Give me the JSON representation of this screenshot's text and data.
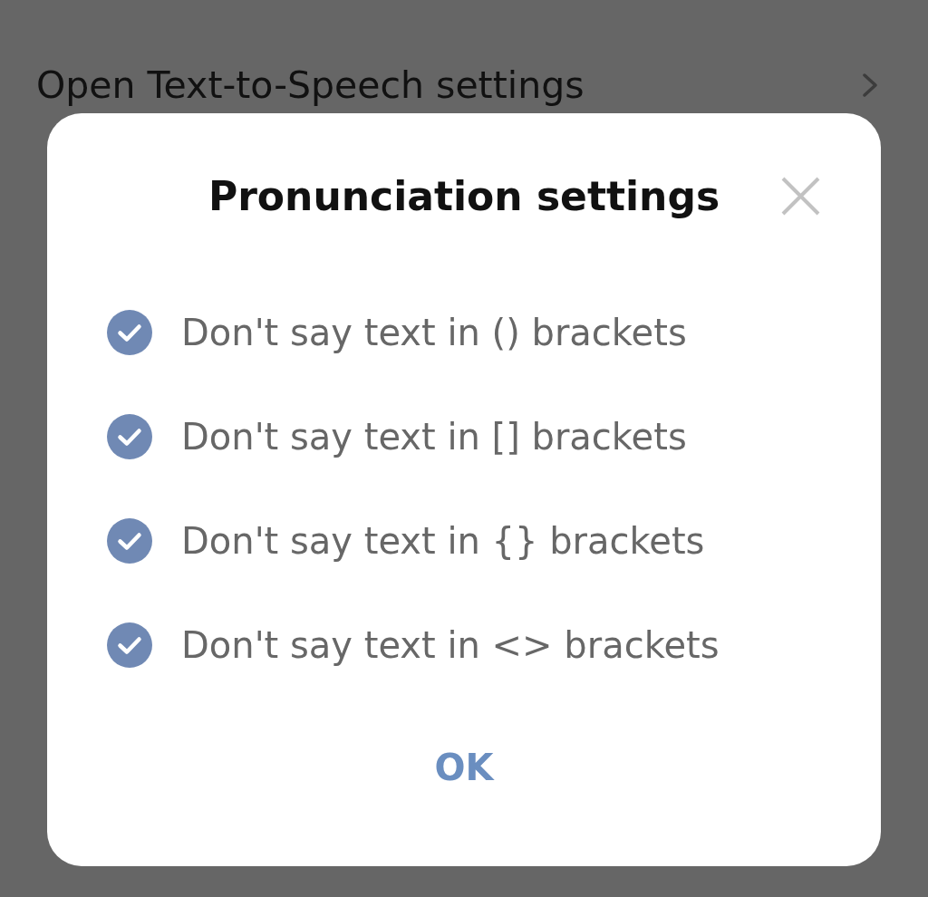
{
  "settings_row": {
    "label": "Open Text-to-Speech settings"
  },
  "dialog": {
    "title": "Pronunciation settings",
    "options": [
      {
        "label": "Don't say text in () brackets",
        "checked": true
      },
      {
        "label": "Don't say text in [] brackets",
        "checked": true
      },
      {
        "label": "Don't say text in {} brackets",
        "checked": true
      },
      {
        "label": "Don't say text in <> brackets",
        "checked": true
      }
    ],
    "button": "OK"
  }
}
